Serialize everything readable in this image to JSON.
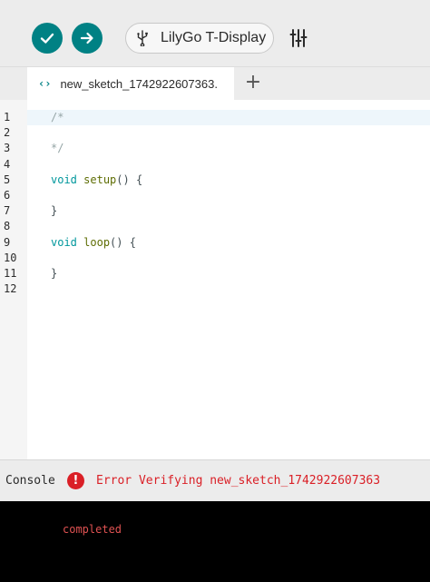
{
  "toolbar": {
    "verify_icon": "check-icon",
    "upload_icon": "arrow-right-icon",
    "board_icon": "usb-icon",
    "board_label": "LilyGo T-Display",
    "serial_plotter_icon": "sliders-icon"
  },
  "tabs": [
    {
      "icon": "code-icon",
      "icon_glyph": "‹›",
      "label": "new_sketch_1742922607363."
    }
  ],
  "add_tab_glyph": "+",
  "editor": {
    "line_numbers": [
      "1",
      "2",
      "3",
      "4",
      "5",
      "6",
      "7",
      "8",
      "9",
      "10",
      "11",
      "12"
    ],
    "lines": [
      "/*",
      "",
      "*/",
      "",
      "void setup() {",
      "",
      "}",
      "",
      "void loop() {",
      "",
      "}",
      ""
    ]
  },
  "console": {
    "title": "Console",
    "error_glyph": "!",
    "status": "Error Verifying new_sketch_1742922607363",
    "output": "completed"
  },
  "colors": {
    "accent": "#008184",
    "error": "#da1f26"
  }
}
